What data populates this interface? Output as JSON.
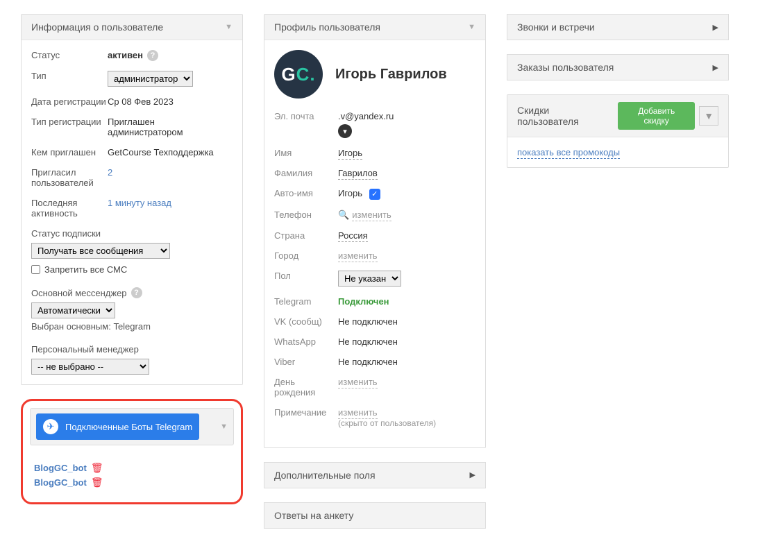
{
  "col1": {
    "infoPanel": {
      "title": "Информация о пользователе",
      "status_label": "Статус",
      "status_value": "активен",
      "type_label": "Тип",
      "type_options": [
        "администратор"
      ],
      "type_selected": "администратор",
      "regdate_label": "Дата регистрации",
      "regdate_value": "Ср 08 Фев 2023",
      "regtype_label": "Тип регистрации",
      "regtype_value": "Приглашен администратором",
      "invitedby_label": "Кем приглашен",
      "invitedby_value": "GetCourse Техподдержка",
      "invitedcount_label": "Пригласил пользователей",
      "invitedcount_value": "2",
      "last_label": "Последняя активность",
      "last_value": "1 минуту назад",
      "sub_label": "Статус подписки",
      "sub_options": [
        "Получать все сообщения"
      ],
      "sub_selected": "Получать все сообщения",
      "block_sms": "Запретить все СМС",
      "main_msgr_label": "Основной мессенджер",
      "main_msgr_options": [
        "Автоматически"
      ],
      "main_msgr_selected": "Автоматически",
      "main_msgr_note": "Выбран основным: Telegram",
      "manager_label": "Персональный менеджер",
      "manager_options": [
        "-- не выбрано --"
      ],
      "manager_selected": "-- не выбрано --"
    },
    "tgPanel": {
      "title": "Подключенные Боты Telegram",
      "bots": [
        "BlogGC_bot",
        "BlogGC_bot"
      ]
    }
  },
  "col2": {
    "profilePanel": {
      "title": "Профиль пользователя",
      "avatar_text_g": "G",
      "avatar_text_c": "C",
      "avatar_dot": ".",
      "name": "Игорь Гаврилов",
      "email_label": "Эл. почта",
      "email_blur": "        ",
      "email_visible": ".v@yandex.ru",
      "firstname_label": "Имя",
      "firstname_value": "Игорь",
      "lastname_label": "Фамилия",
      "lastname_value": "Гаврилов",
      "autoname_label": "Авто-имя",
      "autoname_value": "Игорь",
      "phone_label": "Телефон",
      "phone_value": "изменить",
      "country_label": "Страна",
      "country_value": "Россия",
      "city_label": "Город",
      "city_value": "изменить",
      "gender_label": "Пол",
      "gender_options": [
        "Не указан"
      ],
      "gender_selected": "Не указан",
      "telegram_label": "Telegram",
      "telegram_value": "Подключен",
      "vk_label": "VK (сообщ)",
      "vk_value": "Не подключен",
      "wa_label": "WhatsApp",
      "wa_value": "Не подключен",
      "viber_label": "Viber",
      "viber_value": "Не подключен",
      "bday_label": "День рождения",
      "bday_value": "изменить",
      "note_label": "Примечание",
      "note_value": "изменить",
      "note_hint": "(скрыто от пользователя)"
    },
    "extraFields": "Дополнительные поля",
    "surveyAnswers": "Ответы на анкету"
  },
  "col3": {
    "calls": "Звонки и встречи",
    "orders": "Заказы пользователя",
    "discounts_title": "Скидки пользователя",
    "add_discount": "Добавить скидку",
    "show_promo": "показать все промокоды"
  }
}
